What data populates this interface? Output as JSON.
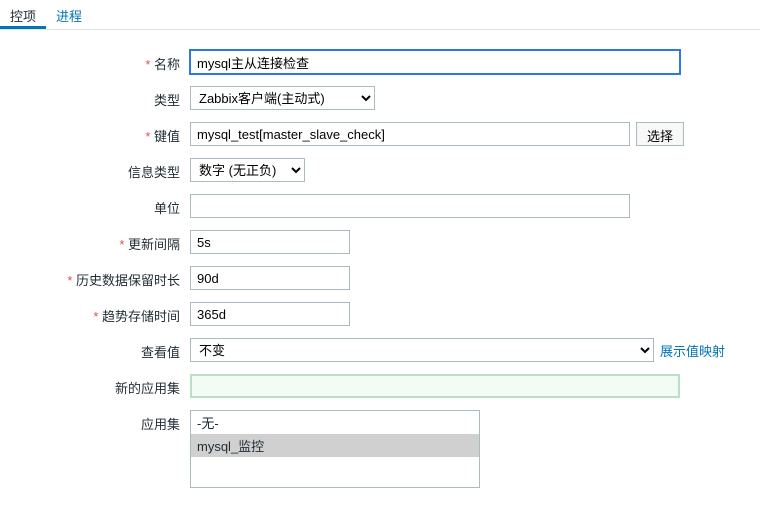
{
  "tabs": {
    "items": [
      {
        "label": "控项",
        "active": true
      },
      {
        "label": "进程",
        "active": false
      }
    ]
  },
  "form": {
    "name": {
      "label": "名称",
      "value": "mysql主从连接检查"
    },
    "type": {
      "label": "类型",
      "selected": "Zabbix客户端(主动式)"
    },
    "key": {
      "label": "键值",
      "value": "mysql_test[master_slave_check]",
      "button": "选择"
    },
    "infoType": {
      "label": "信息类型",
      "selected": "数字 (无正负)"
    },
    "units": {
      "label": "单位",
      "value": ""
    },
    "updateInterval": {
      "label": "更新间隔",
      "value": "5s"
    },
    "historyRetention": {
      "label": "历史数据保留时长",
      "value": "90d"
    },
    "trendsRetention": {
      "label": "趋势存储时间",
      "value": "365d"
    },
    "viewValue": {
      "label": "查看值",
      "selected": "不变",
      "link": "展示值映射"
    },
    "newApplication": {
      "label": "新的应用集",
      "value": ""
    },
    "applications": {
      "label": "应用集",
      "options": [
        {
          "text": "-无-",
          "selected": false
        },
        {
          "text": "mysql_监控",
          "selected": true
        }
      ]
    }
  }
}
